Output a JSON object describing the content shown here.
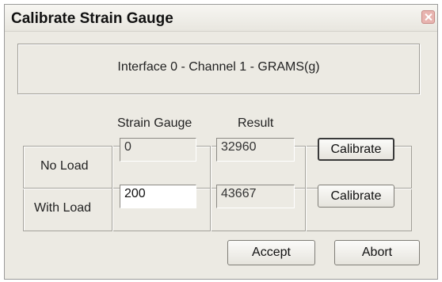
{
  "window": {
    "title": "Calibrate Strain Gauge"
  },
  "header": {
    "text": "Interface 0 - Channel 1 - GRAMS(g)"
  },
  "columns": {
    "strain_gauge": "Strain Gauge",
    "result": "Result"
  },
  "rows": [
    {
      "label": "No Load",
      "strain_value": "0",
      "result_value": "32960",
      "button": "Calibrate"
    },
    {
      "label": "With Load",
      "strain_value": "200",
      "result_value": "43667",
      "button": "Calibrate"
    }
  ],
  "footer": {
    "accept": "Accept",
    "abort": "Abort"
  }
}
